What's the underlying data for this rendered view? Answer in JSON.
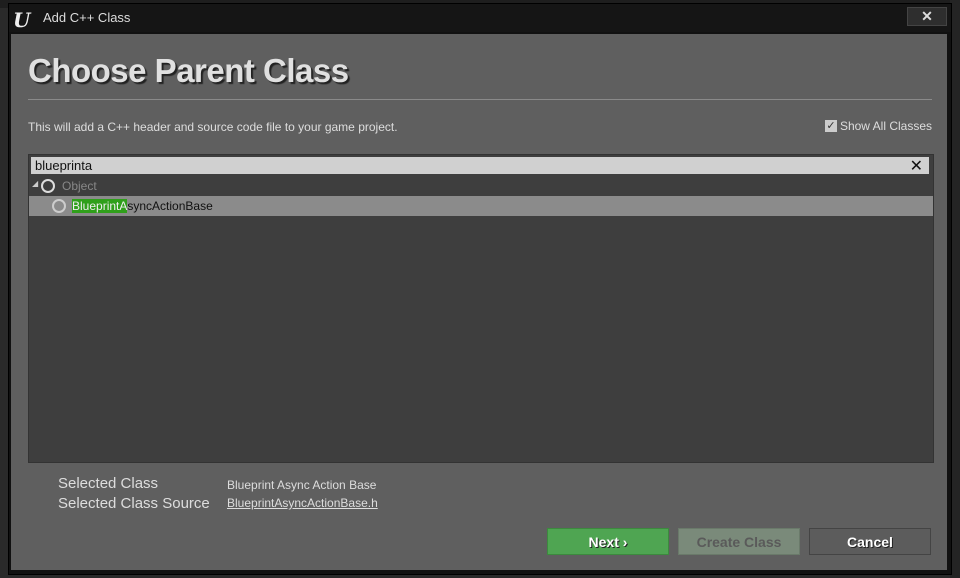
{
  "window": {
    "title": "Add C++ Class",
    "logo": "U",
    "close": "✕"
  },
  "header": {
    "title": "Choose Parent Class",
    "description": "This will add a C++ header and source code file to your game project."
  },
  "show_all": {
    "label": "Show All Classes",
    "checked": true,
    "check": "✓"
  },
  "search": {
    "value": "blueprinta",
    "clear": "✕"
  },
  "tree": {
    "expander": "◢",
    "root": "Object",
    "child_match": "BlueprintA",
    "child_rest": "syncActionBase"
  },
  "selection": {
    "class_label": "Selected Class",
    "class_value": "Blueprint Async Action Base",
    "source_label": "Selected Class Source",
    "source_value": "BlueprintAsyncActionBase.h"
  },
  "buttons": {
    "next": "Next",
    "next_arrow": "›",
    "create": "Create Class",
    "cancel": "Cancel"
  },
  "colors": {
    "accent": "#4fa552",
    "highlight": "#2f9f1a"
  }
}
